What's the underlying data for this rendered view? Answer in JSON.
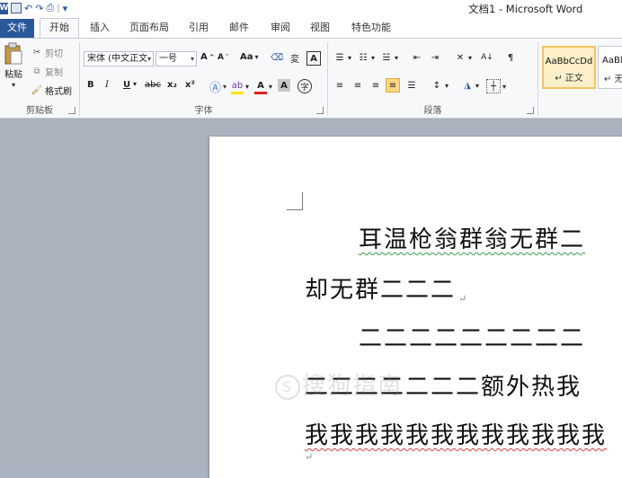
{
  "window": {
    "title": "文档1 - Microsoft Word"
  },
  "qat": {
    "logo": "W",
    "undo": "↶",
    "redo": "↷",
    "customize": "▾"
  },
  "tabs": [
    {
      "label": "文件"
    },
    {
      "label": "开始"
    },
    {
      "label": "插入"
    },
    {
      "label": "页面布局"
    },
    {
      "label": "引用"
    },
    {
      "label": "邮件"
    },
    {
      "label": "审阅"
    },
    {
      "label": "视图"
    },
    {
      "label": "特色功能"
    }
  ],
  "clipboard": {
    "paste": "粘贴",
    "cut": "剪切",
    "copy": "复制",
    "format_painter": "格式刷",
    "label": "剪贴板"
  },
  "font": {
    "name": "宋体 (中文正文",
    "size": "一号",
    "grow": "A",
    "shrink": "A",
    "case": "Aa",
    "bold": "B",
    "italic": "I",
    "underline": "U",
    "strike": "abc",
    "subscript": "x₂",
    "superscript": "x²",
    "label": "字体"
  },
  "paragraph": {
    "label": "段落"
  },
  "styles": [
    {
      "sample": "AaBbCcDd",
      "name": "↵ 正文"
    },
    {
      "sample": "AaBl",
      "name": "↵ 无"
    }
  ],
  "document": {
    "lines": [
      "耳温枪翁群翁无群二",
      "却无群二二二",
      "二二二二二二二二二",
      "二二二二二二二额外热我",
      "我我我我我我我我我我我我"
    ],
    "watermark": "搜狗指南"
  }
}
